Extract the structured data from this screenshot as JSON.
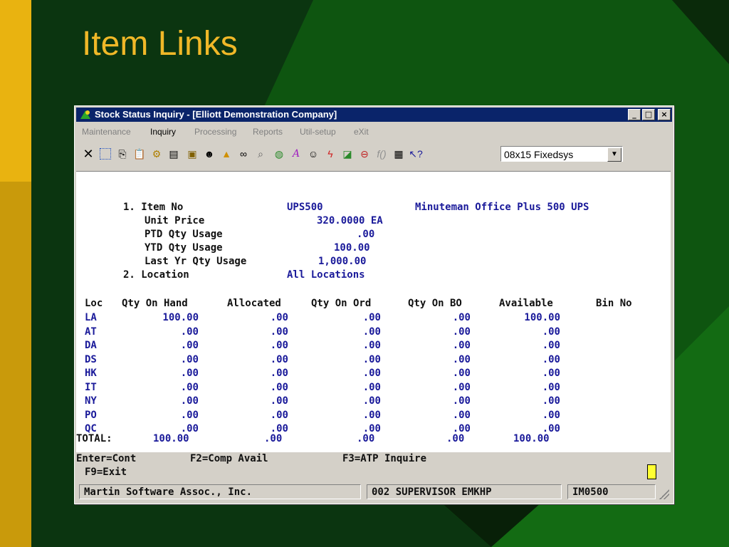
{
  "slide": {
    "title": "Item Links"
  },
  "window": {
    "title": "Stock Status Inquiry - [Elliott Demonstration Company]",
    "controls": [
      "_",
      "□",
      "×"
    ]
  },
  "menu": [
    "Maintenance",
    "Inquiry",
    "Processing",
    "Reports",
    "Util-setup",
    "eXit"
  ],
  "toolbar": {
    "icons": [
      "close-x-icon",
      "select-icon",
      "copy-icon",
      "paste-icon",
      "settings-gear-icon",
      "properties-icon",
      "notepad-icon",
      "find-user-icon",
      "alert-icon",
      "binoculars-icon",
      "magnifier-icon",
      "globe-icon",
      "font-icon",
      "user-help-icon",
      "lightning-icon",
      "chart-icon",
      "link-icon",
      "function-icon",
      "calculator-icon",
      "whats-this-icon"
    ],
    "font_select": "08x15 Fixedsys"
  },
  "inquiry": {
    "item_no_label": "1. Item No",
    "item_no": "UPS500",
    "item_desc": "Minuteman Office Plus 500 UPS",
    "unit_price_label": "Unit Price",
    "unit_price": "320.0000 EA",
    "ptd_label": "PTD Qty Usage",
    "ptd": ".00",
    "ytd_label": "YTD Qty Usage",
    "ytd": "100.00",
    "last_yr_label": "Last Yr Qty Usage",
    "last_yr": "1,000.00",
    "location_label": "2. Location",
    "location": "All Locations"
  },
  "table": {
    "headers": [
      "Loc",
      "Qty On Hand",
      "Allocated",
      "Qty On Ord",
      "Qty On BO",
      "Available",
      "Bin No"
    ],
    "rows": [
      {
        "loc": "LA",
        "on_hand": "100.00",
        "allocated": ".00",
        "on_ord": ".00",
        "on_bo": ".00",
        "available": "100.00"
      },
      {
        "loc": "AT",
        "on_hand": ".00",
        "allocated": ".00",
        "on_ord": ".00",
        "on_bo": ".00",
        "available": ".00"
      },
      {
        "loc": "DA",
        "on_hand": ".00",
        "allocated": ".00",
        "on_ord": ".00",
        "on_bo": ".00",
        "available": ".00"
      },
      {
        "loc": "DS",
        "on_hand": ".00",
        "allocated": ".00",
        "on_ord": ".00",
        "on_bo": ".00",
        "available": ".00"
      },
      {
        "loc": "HK",
        "on_hand": ".00",
        "allocated": ".00",
        "on_ord": ".00",
        "on_bo": ".00",
        "available": ".00"
      },
      {
        "loc": "IT",
        "on_hand": ".00",
        "allocated": ".00",
        "on_ord": ".00",
        "on_bo": ".00",
        "available": ".00"
      },
      {
        "loc": "NY",
        "on_hand": ".00",
        "allocated": ".00",
        "on_ord": ".00",
        "on_bo": ".00",
        "available": ".00"
      },
      {
        "loc": "PO",
        "on_hand": ".00",
        "allocated": ".00",
        "on_ord": ".00",
        "on_bo": ".00",
        "available": ".00"
      },
      {
        "loc": "QC",
        "on_hand": ".00",
        "allocated": ".00",
        "on_ord": ".00",
        "on_bo": ".00",
        "available": ".00"
      }
    ],
    "total": {
      "label": "TOTAL:",
      "on_hand": "100.00",
      "allocated": ".00",
      "on_ord": ".00",
      "on_bo": ".00",
      "available": "100.00"
    }
  },
  "commands": {
    "enter": "Enter=Cont",
    "f2": "F2=Comp Avail",
    "f3": "F3=ATP Inquire",
    "f9": "F9=Exit"
  },
  "status": {
    "company": "Martin Software Assoc., Inc.",
    "user": "002 SUPERVISOR EMKHP",
    "program": "IM0500"
  }
}
